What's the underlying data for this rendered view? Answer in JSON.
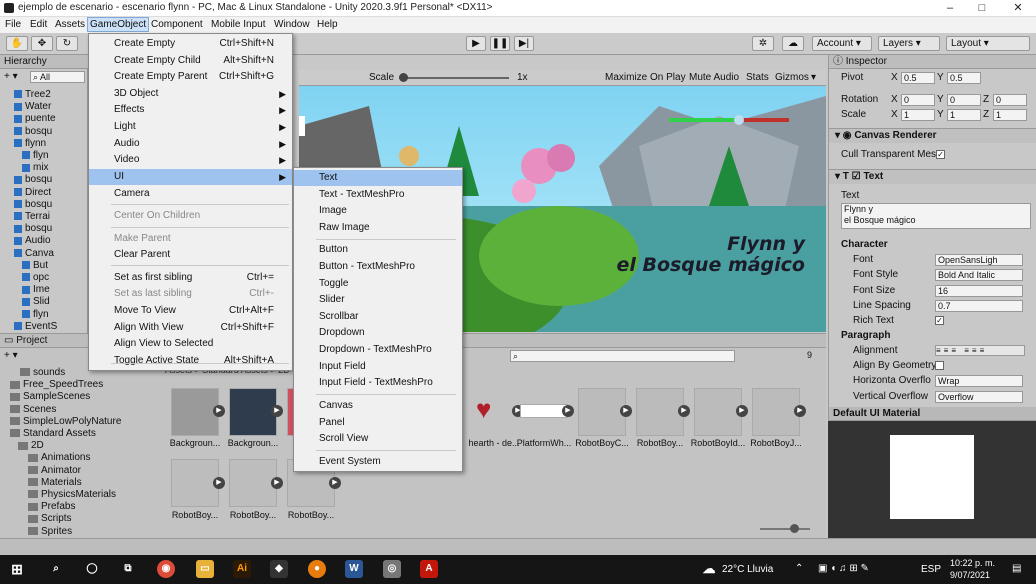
{
  "window": {
    "title": "ejemplo de escenario - escenario flynn - PC, Mac & Linux Standalone - Unity 2020.3.9f1 Personal* <DX11>",
    "min": "–",
    "max": "□",
    "close": "✕"
  },
  "menubar": [
    "File",
    "Edit",
    "Assets",
    "GameObject",
    "Component",
    "Mobile Input",
    "Window",
    "Help"
  ],
  "toolbar": {
    "account": "Account",
    "layers": "Layers",
    "layout": "Layout"
  },
  "hierarchy": {
    "tab": "Hierarchy",
    "search": "All",
    "rows": [
      "Tree2",
      "Water",
      "puente",
      "bosqu",
      "flynn",
      "flyn",
      "mix",
      "bosqu",
      "Direct",
      "bosqu",
      "Terrai",
      "bosqu",
      "Audio",
      "Canva",
      "But",
      "opc",
      "Ime",
      "Slid",
      "flyn",
      "EventS"
    ]
  },
  "gameview": {
    "scale_label": "Scale",
    "scale_value": "1x",
    "maximize": "Maximize On Play",
    "mute": "Mute Audio",
    "stats": "Stats",
    "gizmos": "Gizmos",
    "title_line1": "Flynn y",
    "title_line2": "el Bosque mágico"
  },
  "inspector": {
    "tab": "Inspector",
    "pivot": {
      "label": "Pivot",
      "x": "0.5",
      "y": "0.5"
    },
    "rotation": {
      "label": "Rotation",
      "x": "0",
      "y": "0",
      "z": "0"
    },
    "scale": {
      "label": "Scale",
      "x": "1",
      "y": "1",
      "z": "1"
    },
    "canvas_renderer": "Canvas Renderer",
    "cull": "Cull Transparent Mes",
    "text_component": "Text",
    "text_label": "Text",
    "text_value_1": "Flynn y",
    "text_value_2": "el Bosque mágico",
    "character": "Character",
    "font_label": "Font",
    "font_value": "OpenSansLigh",
    "fontstyle_label": "Font Style",
    "fontstyle_value": "Bold And Italic",
    "fontsize_label": "Font Size",
    "fontsize_value": "16",
    "linespacing_label": "Line Spacing",
    "linespacing_value": "0.7",
    "richtext_label": "Rich Text",
    "paragraph": "Paragraph",
    "alignment": "Alignment",
    "alignbygeom": "Align By Geometry",
    "horiz_label": "Horizonta Overflo",
    "horiz_value": "Wrap",
    "vert_label": "Vertical Overflow",
    "vert_value": "Overflow",
    "material": "Default UI Material"
  },
  "project": {
    "tab": "Project",
    "breadcrumb": "Assets > Standard Assets > 2D",
    "tree": [
      "sounds",
      "Free_SpeedTrees",
      "SampleScenes",
      "Scenes",
      "SimpleLowPolyNature",
      "Standard Assets",
      "2D",
      "Animations",
      "Animator",
      "Materials",
      "PhysicsMaterials",
      "Prefabs",
      "Scripts",
      "Sprites"
    ],
    "assets_row1": [
      "Backgroun...",
      "Backgroun...",
      "",
      "hearth - de...",
      "PlatformWh...",
      "RobotBoyC...",
      "RobotBoy...",
      "RobotBoyId...",
      "RobotBoyJ..."
    ],
    "assets_row2": [
      "RobotBoy...",
      "RobotBoy...",
      "RobotBoy..."
    ],
    "count": "9"
  },
  "gameobject_menu": [
    {
      "label": "Create Empty",
      "shortcut": "Ctrl+Shift+N"
    },
    {
      "label": "Create Empty Child",
      "shortcut": "Alt+Shift+N"
    },
    {
      "label": "Create Empty Parent",
      "shortcut": "Ctrl+Shift+G"
    },
    {
      "label": "3D Object",
      "shortcut": ""
    },
    {
      "label": "Effects",
      "shortcut": ""
    },
    {
      "label": "Light",
      "shortcut": ""
    },
    {
      "label": "Audio",
      "shortcut": ""
    },
    {
      "label": "Video",
      "shortcut": ""
    },
    {
      "label": "UI",
      "shortcut": ""
    },
    {
      "label": "Camera",
      "shortcut": ""
    },
    {
      "label": "Center On Children",
      "shortcut": ""
    },
    {
      "label": "Make Parent",
      "shortcut": ""
    },
    {
      "label": "Clear Parent",
      "shortcut": ""
    },
    {
      "label": "Set as first sibling",
      "shortcut": "Ctrl+="
    },
    {
      "label": "Set as last sibling",
      "shortcut": "Ctrl+-"
    },
    {
      "label": "Move To View",
      "shortcut": "Ctrl+Alt+F"
    },
    {
      "label": "Align With View",
      "shortcut": "Ctrl+Shift+F"
    },
    {
      "label": "Align View to Selected",
      "shortcut": ""
    },
    {
      "label": "Toggle Active State",
      "shortcut": "Alt+Shift+A"
    }
  ],
  "ui_submenu": [
    "Text",
    "Text - TextMeshPro",
    "Image",
    "Raw Image",
    "Button",
    "Button - TextMeshPro",
    "Toggle",
    "Slider",
    "Scrollbar",
    "Dropdown",
    "Dropdown - TextMeshPro",
    "Input Field",
    "Input Field - TextMeshPro",
    "Canvas",
    "Panel",
    "Scroll View",
    "Event System"
  ],
  "taskbar": {
    "weather": "22°C Lluvia",
    "lang": "ESP",
    "time": "10:22 p. m.",
    "date": "9/07/2021"
  }
}
